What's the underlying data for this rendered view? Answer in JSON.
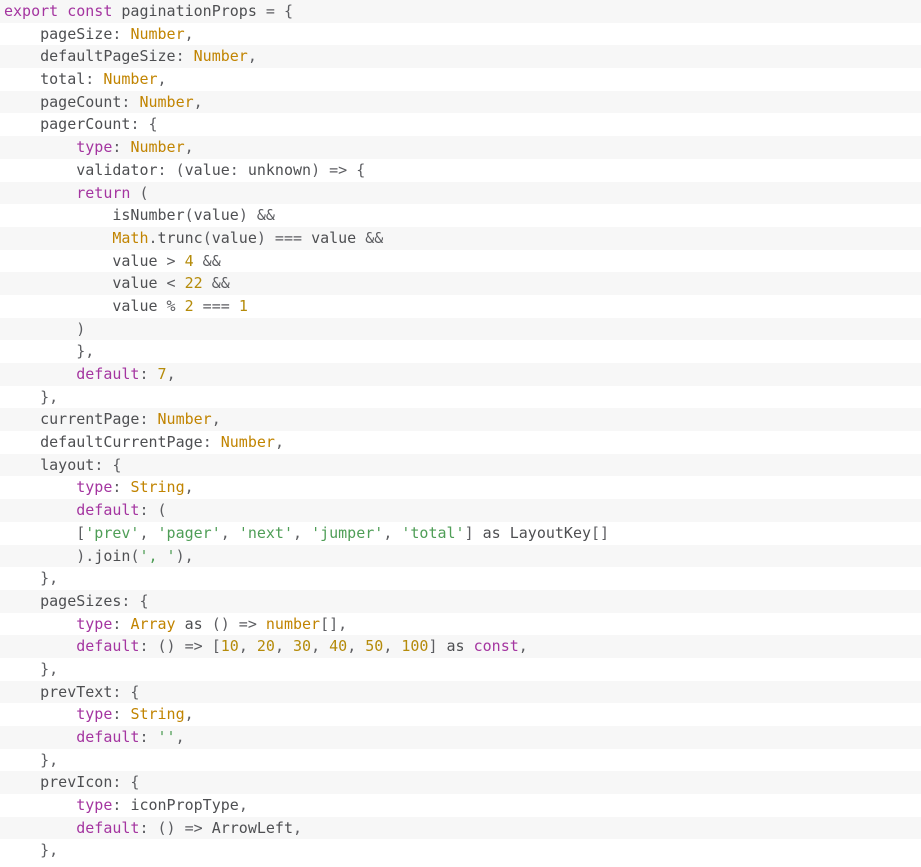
{
  "editor": {
    "language": "typescript",
    "file_kind": "source-code-view",
    "background": "#ffffff",
    "stripe_background": "#f7f7f7",
    "colors": {
      "plain": "#4e4f52",
      "keyword": "#a435a0",
      "type": "#c18401",
      "number": "#b58b0a",
      "string": "#4f9e57",
      "punctuation": "#5c5d61"
    }
  },
  "code": {
    "lines": [
      {
        "n": 1,
        "text": "export const paginationProps = {",
        "tokens": [
          {
            "t": "export",
            "c": "keyword"
          },
          {
            "t": " ",
            "c": "plain"
          },
          {
            "t": "const",
            "c": "keyword"
          },
          {
            "t": " ",
            "c": "plain"
          },
          {
            "t": "paginationProps",
            "c": "ident"
          },
          {
            "t": " = {",
            "c": "punct"
          }
        ]
      },
      {
        "n": 2,
        "text": "    pageSize: Number,",
        "tokens": [
          {
            "t": "    ",
            "c": "plain"
          },
          {
            "t": "pageSize",
            "c": "ident"
          },
          {
            "t": ": ",
            "c": "punct"
          },
          {
            "t": "Number",
            "c": "type"
          },
          {
            "t": ",",
            "c": "punct"
          }
        ]
      },
      {
        "n": 3,
        "text": "    defaultPageSize: Number,",
        "tokens": [
          {
            "t": "    ",
            "c": "plain"
          },
          {
            "t": "defaultPageSize",
            "c": "ident"
          },
          {
            "t": ": ",
            "c": "punct"
          },
          {
            "t": "Number",
            "c": "type"
          },
          {
            "t": ",",
            "c": "punct"
          }
        ]
      },
      {
        "n": 4,
        "text": "    total: Number,",
        "tokens": [
          {
            "t": "    ",
            "c": "plain"
          },
          {
            "t": "total",
            "c": "ident"
          },
          {
            "t": ": ",
            "c": "punct"
          },
          {
            "t": "Number",
            "c": "type"
          },
          {
            "t": ",",
            "c": "punct"
          }
        ]
      },
      {
        "n": 5,
        "text": "    pageCount: Number,",
        "tokens": [
          {
            "t": "    ",
            "c": "plain"
          },
          {
            "t": "pageCount",
            "c": "ident"
          },
          {
            "t": ": ",
            "c": "punct"
          },
          {
            "t": "Number",
            "c": "type"
          },
          {
            "t": ",",
            "c": "punct"
          }
        ]
      },
      {
        "n": 6,
        "text": "    pagerCount: {",
        "tokens": [
          {
            "t": "    ",
            "c": "plain"
          },
          {
            "t": "pagerCount",
            "c": "ident"
          },
          {
            "t": ": {",
            "c": "punct"
          }
        ]
      },
      {
        "n": 7,
        "text": "        type: Number,",
        "tokens": [
          {
            "t": "        ",
            "c": "plain"
          },
          {
            "t": "type",
            "c": "keyword"
          },
          {
            "t": ": ",
            "c": "punct"
          },
          {
            "t": "Number",
            "c": "type"
          },
          {
            "t": ",",
            "c": "punct"
          }
        ]
      },
      {
        "n": 8,
        "text": "        validator: (value: unknown) => {",
        "tokens": [
          {
            "t": "        ",
            "c": "plain"
          },
          {
            "t": "validator",
            "c": "ident"
          },
          {
            "t": ": (",
            "c": "punct"
          },
          {
            "t": "value",
            "c": "ident"
          },
          {
            "t": ": ",
            "c": "punct"
          },
          {
            "t": "unknown",
            "c": "ident"
          },
          {
            "t": ") => {",
            "c": "punct"
          }
        ]
      },
      {
        "n": 9,
        "text": "        return (",
        "tokens": [
          {
            "t": "        ",
            "c": "plain"
          },
          {
            "t": "return",
            "c": "keyword"
          },
          {
            "t": " (",
            "c": "punct"
          }
        ]
      },
      {
        "n": 10,
        "text": "            isNumber(value) &&",
        "tokens": [
          {
            "t": "            ",
            "c": "plain"
          },
          {
            "t": "isNumber",
            "c": "ident"
          },
          {
            "t": "(",
            "c": "punct"
          },
          {
            "t": "value",
            "c": "ident"
          },
          {
            "t": ") &&",
            "c": "punct"
          }
        ]
      },
      {
        "n": 11,
        "text": "            Math.trunc(value) === value &&",
        "tokens": [
          {
            "t": "            ",
            "c": "plain"
          },
          {
            "t": "Math",
            "c": "type"
          },
          {
            "t": ".",
            "c": "punct"
          },
          {
            "t": "trunc",
            "c": "ident"
          },
          {
            "t": "(",
            "c": "punct"
          },
          {
            "t": "value",
            "c": "ident"
          },
          {
            "t": ") === ",
            "c": "punct"
          },
          {
            "t": "value",
            "c": "ident"
          },
          {
            "t": " &&",
            "c": "punct"
          }
        ]
      },
      {
        "n": 12,
        "text": "            value > 4 &&",
        "tokens": [
          {
            "t": "            ",
            "c": "plain"
          },
          {
            "t": "value",
            "c": "ident"
          },
          {
            "t": " > ",
            "c": "punct"
          },
          {
            "t": "4",
            "c": "number"
          },
          {
            "t": " &&",
            "c": "punct"
          }
        ]
      },
      {
        "n": 13,
        "text": "            value < 22 &&",
        "tokens": [
          {
            "t": "            ",
            "c": "plain"
          },
          {
            "t": "value",
            "c": "ident"
          },
          {
            "t": " < ",
            "c": "punct"
          },
          {
            "t": "22",
            "c": "number"
          },
          {
            "t": " &&",
            "c": "punct"
          }
        ]
      },
      {
        "n": 14,
        "text": "            value % 2 === 1",
        "tokens": [
          {
            "t": "            ",
            "c": "plain"
          },
          {
            "t": "value",
            "c": "ident"
          },
          {
            "t": " % ",
            "c": "punct"
          },
          {
            "t": "2",
            "c": "number"
          },
          {
            "t": " === ",
            "c": "punct"
          },
          {
            "t": "1",
            "c": "number"
          }
        ]
      },
      {
        "n": 15,
        "text": "        )",
        "tokens": [
          {
            "t": "        ",
            "c": "plain"
          },
          {
            "t": ")",
            "c": "punct"
          }
        ]
      },
      {
        "n": 16,
        "text": "        },",
        "tokens": [
          {
            "t": "        ",
            "c": "plain"
          },
          {
            "t": "},",
            "c": "punct"
          }
        ]
      },
      {
        "n": 17,
        "text": "        default: 7,",
        "tokens": [
          {
            "t": "        ",
            "c": "plain"
          },
          {
            "t": "default",
            "c": "keyword"
          },
          {
            "t": ": ",
            "c": "punct"
          },
          {
            "t": "7",
            "c": "number"
          },
          {
            "t": ",",
            "c": "punct"
          }
        ]
      },
      {
        "n": 18,
        "text": "    },",
        "tokens": [
          {
            "t": "    ",
            "c": "plain"
          },
          {
            "t": "},",
            "c": "punct"
          }
        ]
      },
      {
        "n": 19,
        "text": "    currentPage: Number,",
        "tokens": [
          {
            "t": "    ",
            "c": "plain"
          },
          {
            "t": "currentPage",
            "c": "ident"
          },
          {
            "t": ": ",
            "c": "punct"
          },
          {
            "t": "Number",
            "c": "type"
          },
          {
            "t": ",",
            "c": "punct"
          }
        ]
      },
      {
        "n": 20,
        "text": "    defaultCurrentPage: Number,",
        "tokens": [
          {
            "t": "    ",
            "c": "plain"
          },
          {
            "t": "defaultCurrentPage",
            "c": "ident"
          },
          {
            "t": ": ",
            "c": "punct"
          },
          {
            "t": "Number",
            "c": "type"
          },
          {
            "t": ",",
            "c": "punct"
          }
        ]
      },
      {
        "n": 21,
        "text": "    layout: {",
        "tokens": [
          {
            "t": "    ",
            "c": "plain"
          },
          {
            "t": "layout",
            "c": "ident"
          },
          {
            "t": ": {",
            "c": "punct"
          }
        ]
      },
      {
        "n": 22,
        "text": "        type: String,",
        "tokens": [
          {
            "t": "        ",
            "c": "plain"
          },
          {
            "t": "type",
            "c": "keyword"
          },
          {
            "t": ": ",
            "c": "punct"
          },
          {
            "t": "String",
            "c": "type"
          },
          {
            "t": ",",
            "c": "punct"
          }
        ]
      },
      {
        "n": 23,
        "text": "        default: (",
        "tokens": [
          {
            "t": "        ",
            "c": "plain"
          },
          {
            "t": "default",
            "c": "keyword"
          },
          {
            "t": ": (",
            "c": "punct"
          }
        ]
      },
      {
        "n": 24,
        "text": "        ['prev', 'pager', 'next', 'jumper', 'total'] as LayoutKey[]",
        "tokens": [
          {
            "t": "        [",
            "c": "punct"
          },
          {
            "t": "'prev'",
            "c": "string"
          },
          {
            "t": ", ",
            "c": "punct"
          },
          {
            "t": "'pager'",
            "c": "string"
          },
          {
            "t": ", ",
            "c": "punct"
          },
          {
            "t": "'next'",
            "c": "string"
          },
          {
            "t": ", ",
            "c": "punct"
          },
          {
            "t": "'jumper'",
            "c": "string"
          },
          {
            "t": ", ",
            "c": "punct"
          },
          {
            "t": "'total'",
            "c": "string"
          },
          {
            "t": "] ",
            "c": "punct"
          },
          {
            "t": "as",
            "c": "ident"
          },
          {
            "t": " ",
            "c": "plain"
          },
          {
            "t": "LayoutKey",
            "c": "ident"
          },
          {
            "t": "[]",
            "c": "punct"
          }
        ]
      },
      {
        "n": 25,
        "text": "        ).join(', '),",
        "tokens": [
          {
            "t": "        ).",
            "c": "punct"
          },
          {
            "t": "join",
            "c": "ident"
          },
          {
            "t": "(",
            "c": "punct"
          },
          {
            "t": "', '",
            "c": "string"
          },
          {
            "t": "),",
            "c": "punct"
          }
        ]
      },
      {
        "n": 26,
        "text": "    },",
        "tokens": [
          {
            "t": "    ",
            "c": "plain"
          },
          {
            "t": "},",
            "c": "punct"
          }
        ]
      },
      {
        "n": 27,
        "text": "    pageSizes: {",
        "tokens": [
          {
            "t": "    ",
            "c": "plain"
          },
          {
            "t": "pageSizes",
            "c": "ident"
          },
          {
            "t": ": {",
            "c": "punct"
          }
        ]
      },
      {
        "n": 28,
        "text": "        type: Array as () => number[],",
        "tokens": [
          {
            "t": "        ",
            "c": "plain"
          },
          {
            "t": "type",
            "c": "keyword"
          },
          {
            "t": ": ",
            "c": "punct"
          },
          {
            "t": "Array",
            "c": "type"
          },
          {
            "t": " ",
            "c": "plain"
          },
          {
            "t": "as",
            "c": "ident"
          },
          {
            "t": " () => ",
            "c": "punct"
          },
          {
            "t": "number",
            "c": "type"
          },
          {
            "t": "[],",
            "c": "punct"
          }
        ]
      },
      {
        "n": 29,
        "text": "        default: () => [10, 20, 30, 40, 50, 100] as const,",
        "tokens": [
          {
            "t": "        ",
            "c": "plain"
          },
          {
            "t": "default",
            "c": "keyword"
          },
          {
            "t": ": () => [",
            "c": "punct"
          },
          {
            "t": "10",
            "c": "number"
          },
          {
            "t": ", ",
            "c": "punct"
          },
          {
            "t": "20",
            "c": "number"
          },
          {
            "t": ", ",
            "c": "punct"
          },
          {
            "t": "30",
            "c": "number"
          },
          {
            "t": ", ",
            "c": "punct"
          },
          {
            "t": "40",
            "c": "number"
          },
          {
            "t": ", ",
            "c": "punct"
          },
          {
            "t": "50",
            "c": "number"
          },
          {
            "t": ", ",
            "c": "punct"
          },
          {
            "t": "100",
            "c": "number"
          },
          {
            "t": "] ",
            "c": "punct"
          },
          {
            "t": "as",
            "c": "ident"
          },
          {
            "t": " ",
            "c": "plain"
          },
          {
            "t": "const",
            "c": "keyword"
          },
          {
            "t": ",",
            "c": "punct"
          }
        ]
      },
      {
        "n": 30,
        "text": "    },",
        "tokens": [
          {
            "t": "    ",
            "c": "plain"
          },
          {
            "t": "},",
            "c": "punct"
          }
        ]
      },
      {
        "n": 31,
        "text": "    prevText: {",
        "tokens": [
          {
            "t": "    ",
            "c": "plain"
          },
          {
            "t": "prevText",
            "c": "ident"
          },
          {
            "t": ": {",
            "c": "punct"
          }
        ]
      },
      {
        "n": 32,
        "text": "        type: String,",
        "tokens": [
          {
            "t": "        ",
            "c": "plain"
          },
          {
            "t": "type",
            "c": "keyword"
          },
          {
            "t": ": ",
            "c": "punct"
          },
          {
            "t": "String",
            "c": "type"
          },
          {
            "t": ",",
            "c": "punct"
          }
        ]
      },
      {
        "n": 33,
        "text": "        default: '',",
        "tokens": [
          {
            "t": "        ",
            "c": "plain"
          },
          {
            "t": "default",
            "c": "keyword"
          },
          {
            "t": ": ",
            "c": "punct"
          },
          {
            "t": "''",
            "c": "string"
          },
          {
            "t": ",",
            "c": "punct"
          }
        ]
      },
      {
        "n": 34,
        "text": "    },",
        "tokens": [
          {
            "t": "    ",
            "c": "plain"
          },
          {
            "t": "},",
            "c": "punct"
          }
        ]
      },
      {
        "n": 35,
        "text": "    prevIcon: {",
        "tokens": [
          {
            "t": "    ",
            "c": "plain"
          },
          {
            "t": "prevIcon",
            "c": "ident"
          },
          {
            "t": ": {",
            "c": "punct"
          }
        ]
      },
      {
        "n": 36,
        "text": "        type: iconPropType,",
        "tokens": [
          {
            "t": "        ",
            "c": "plain"
          },
          {
            "t": "type",
            "c": "keyword"
          },
          {
            "t": ": ",
            "c": "punct"
          },
          {
            "t": "iconPropType",
            "c": "ident"
          },
          {
            "t": ",",
            "c": "punct"
          }
        ]
      },
      {
        "n": 37,
        "text": "        default: () => ArrowLeft,",
        "tokens": [
          {
            "t": "        ",
            "c": "plain"
          },
          {
            "t": "default",
            "c": "keyword"
          },
          {
            "t": ": () => ",
            "c": "punct"
          },
          {
            "t": "ArrowLeft",
            "c": "ident"
          },
          {
            "t": ",",
            "c": "punct"
          }
        ]
      },
      {
        "n": 38,
        "text": "    },",
        "tokens": [
          {
            "t": "    ",
            "c": "plain"
          },
          {
            "t": "},",
            "c": "punct"
          }
        ]
      }
    ]
  }
}
